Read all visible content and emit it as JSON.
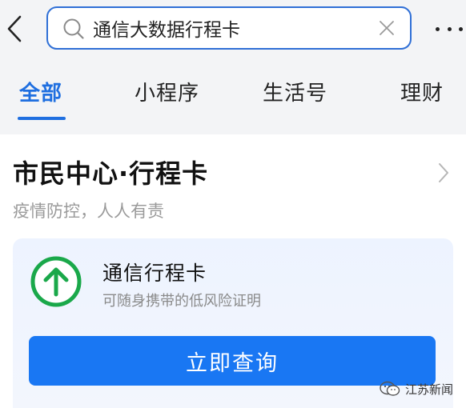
{
  "search": {
    "value": "通信大数据行程卡"
  },
  "tabs": [
    {
      "label": "全部",
      "active": true
    },
    {
      "label": "小程序",
      "active": false
    },
    {
      "label": "生活号",
      "active": false
    },
    {
      "label": "理财",
      "active": false
    }
  ],
  "result_card": {
    "title": "市民中心·行程卡",
    "subtitle": "疫情防控，人人有责",
    "item": {
      "title": "通信行程卡",
      "description": "可随身携带的低风险证明",
      "icon": "up-arrow-circle-icon",
      "icon_color": "#1aa84a"
    },
    "button_label": "立即查询"
  },
  "watermark": {
    "text": "江苏新闻"
  },
  "colors": {
    "accent": "#1f6fe0",
    "button": "#1977f3"
  }
}
